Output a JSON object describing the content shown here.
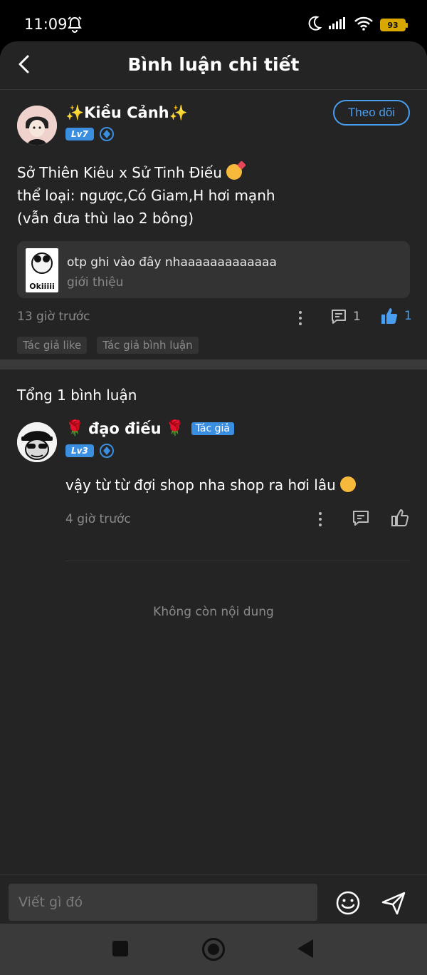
{
  "status_bar": {
    "time": "11:09",
    "battery": "93",
    "icons": [
      "alarm-icon",
      "moon-icon",
      "signal-icon",
      "wifi-icon",
      "battery-icon"
    ]
  },
  "header": {
    "title": "Bình luận chi tiết",
    "back_icon": "chevron-left-icon"
  },
  "post": {
    "author": {
      "name": "Kiều Cảnh",
      "name_decor": "✨",
      "level": "Lv7"
    },
    "follow_label": "Theo dõi",
    "body_lines": [
      "Sở Thiên Kiêu x Sử Tinh Điếu",
      "thể loại: ngược,Có Giam,H hơi mạnh",
      "(vẫn đưa thù lao 2 bông)"
    ],
    "quote": {
      "title": "otp ghi vào đây nhaaaaaaaaaaaaa",
      "subtitle": "giới thiệu",
      "thumb_text": "Okiiiii"
    },
    "time": "13 giờ trước",
    "comment_count": "1",
    "like_count": "1",
    "tags": [
      "Tác giả like",
      "Tác giả bình luận"
    ]
  },
  "comments": {
    "total": "Tổng 1 bình luận",
    "items": [
      {
        "name": "đạo điếu",
        "name_decor": "🌹",
        "author_tag": "Tác giả",
        "level": "Lv3",
        "text": "vậy từ từ đợi shop nha shop ra hơi lâu",
        "time": "4 giờ trước"
      }
    ]
  },
  "end_text": "Không còn nội dung",
  "composer": {
    "placeholder": "Viết gì đó"
  },
  "colors": {
    "accent": "#4a9ef0",
    "background": "#242424",
    "muted_text": "#8a8a8a"
  }
}
